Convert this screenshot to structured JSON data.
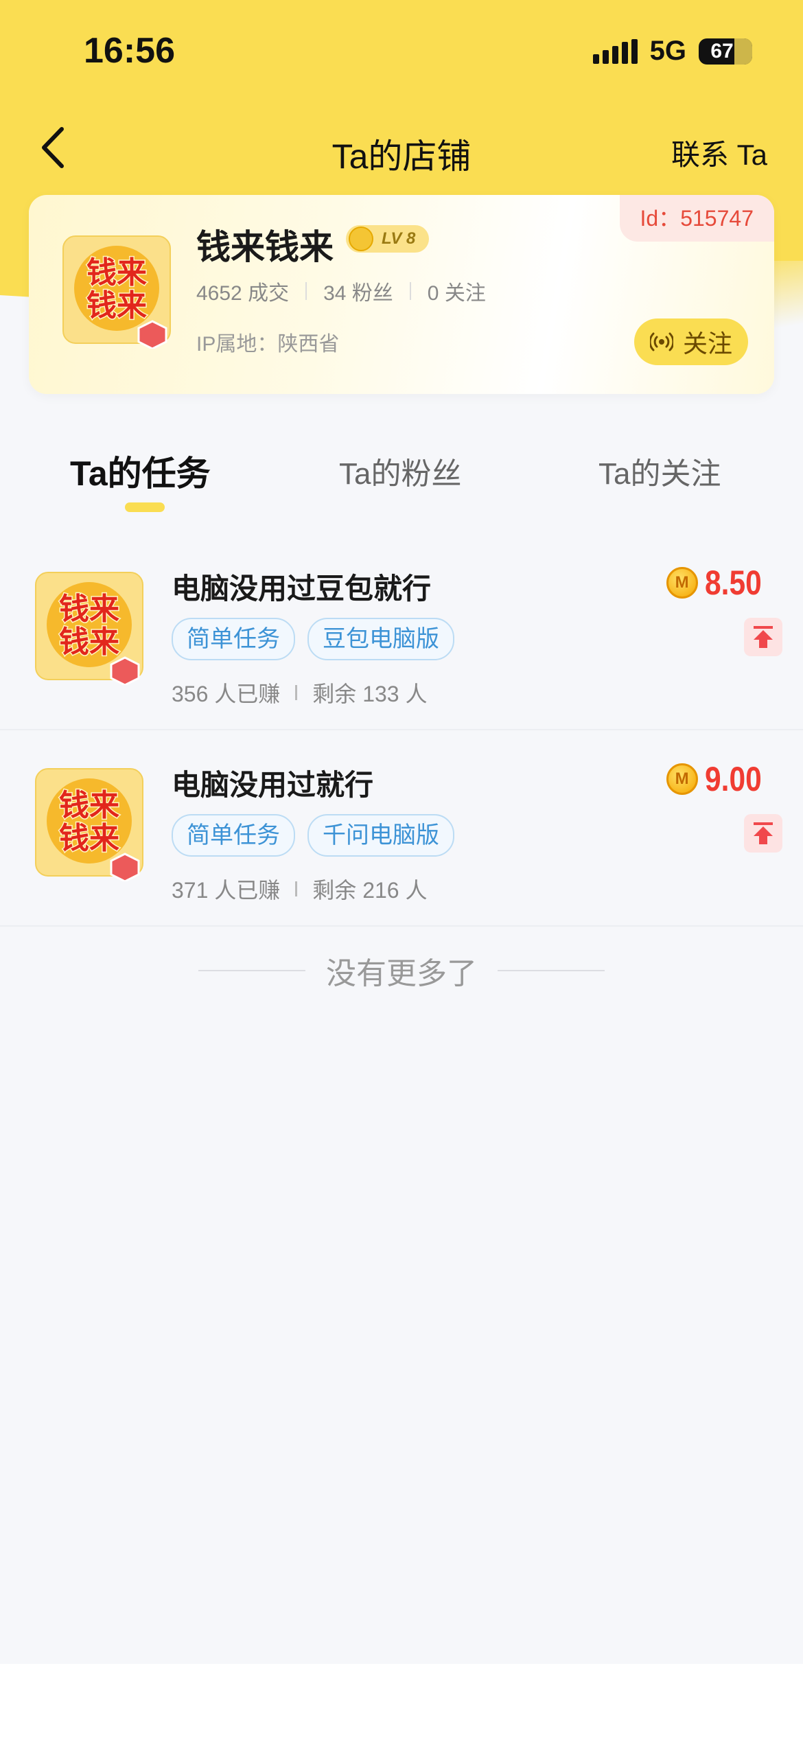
{
  "status_bar": {
    "time": "16:56",
    "network": "5G",
    "battery": "67"
  },
  "nav": {
    "title": "Ta的店铺",
    "contact": "联系 Ta"
  },
  "shop": {
    "id_label": "Id：515747",
    "name": "钱来钱来",
    "level": "LV 8",
    "stats": [
      "4652 成交",
      "34 粉丝",
      "0 关注"
    ],
    "ip": "IP属地：陕西省",
    "follow_label": "关注",
    "avatar_text": [
      "钱来",
      "钱来"
    ]
  },
  "tabs": [
    "Ta的任务",
    "Ta的粉丝",
    "Ta的关注"
  ],
  "tasks": [
    {
      "title": "电脑没用过豆包就行",
      "tags": [
        "简单任务",
        "豆包电脑版"
      ],
      "earned": "356 人已赚",
      "remaining": "剩余 133 人",
      "price": "8.50",
      "thumb_text": [
        "钱来",
        "钱来"
      ]
    },
    {
      "title": "电脑没用过就行",
      "tags": [
        "简单任务",
        "千问电脑版"
      ],
      "earned": "371 人已赚",
      "remaining": "剩余 216 人",
      "price": "9.00",
      "thumb_text": [
        "钱来",
        "钱来"
      ]
    }
  ],
  "footer": {
    "no_more": "没有更多了"
  },
  "colors": {
    "brand_yellow": "#fadd52",
    "price_red": "#f03c32",
    "tag_blue": "#3d93d6",
    "id_red": "#e64a3a"
  },
  "icons": [
    "back-chevron-icon",
    "signal-icon",
    "battery-icon",
    "medal-icon",
    "broadcast-icon",
    "coin-icon",
    "pin-top-icon"
  ]
}
